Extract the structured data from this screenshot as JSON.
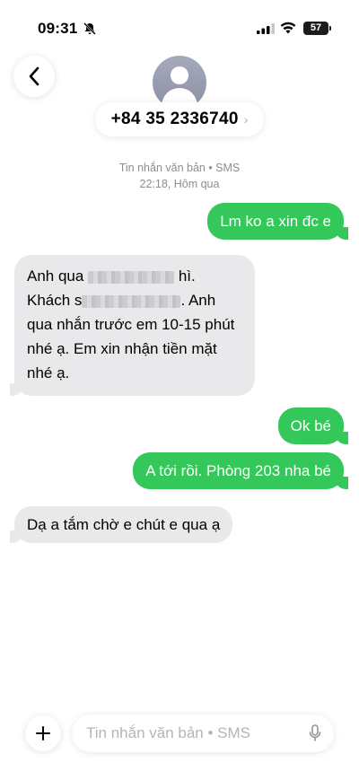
{
  "status": {
    "time": "09:31",
    "battery": "57"
  },
  "header": {
    "contact": "+84 35 2336740",
    "chevron": "›"
  },
  "meta": {
    "type": "Tin nhắn văn bản • SMS",
    "timestamp": "22:18, Hôm qua"
  },
  "messages": {
    "m1": "Lm ko a xin đc e",
    "m2": {
      "p1": "Anh qua",
      "p2": "hì.",
      "p3": "Khách s",
      "p4": ". Anh qua nhắn trước em 10-15 phút nhé ạ. Em xin nhận tiền mặt nhé ạ."
    },
    "m3": "Ok bé",
    "m4": "A tới rồi. Phòng 203 nha bé",
    "m5": "Dạ a tắm chờ e chút e qua ạ"
  },
  "composer": {
    "placeholder": "Tin nhắn văn bản • SMS"
  },
  "colors": {
    "outgoing": "#34c759",
    "incoming": "#e9e9eb",
    "meta": "#8e8e93"
  },
  "icons": [
    "bell-off-icon",
    "signal-icon",
    "wifi-icon",
    "battery-icon",
    "back-chevron-icon",
    "contact-avatar-icon",
    "plus-icon",
    "mic-icon"
  ]
}
